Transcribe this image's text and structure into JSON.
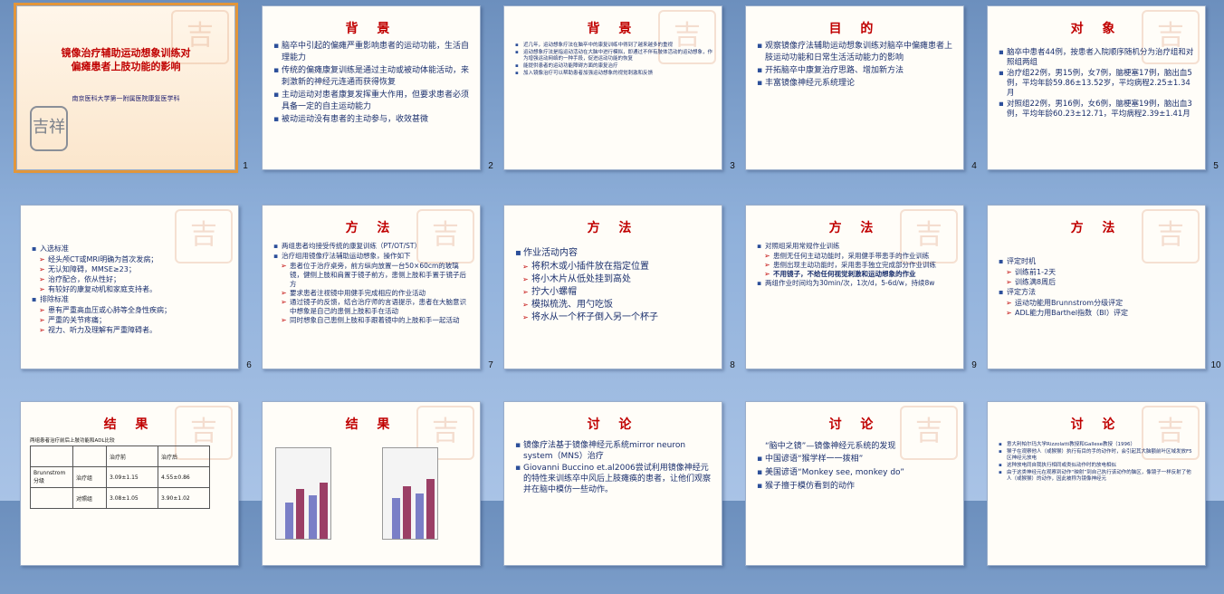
{
  "slides": [
    {
      "num": "1",
      "title_lines": [
        "镜像治疗辅助运动想象训练对",
        "偏瘫患者上肢功能的影响"
      ],
      "affiliation": "南京医科大学第一附属医院康复医学科",
      "seal": "吉祥"
    },
    {
      "num": "2",
      "title": "背 景",
      "bullets": [
        "脑卒中引起的偏瘫严重影响患者的运动功能，生活自理能力",
        "传统的偏瘫康复训练是通过主动或被动体能活动，来刺激新的神经元连通而获得恢复",
        "主动运动对患者康复发挥重大作用，但要求患者必须具备一定的自主运动能力",
        "被动运动没有患者的主动参与，收效甚微"
      ]
    },
    {
      "num": "3",
      "title": "背 景",
      "bullets": [
        "近几年，运动想象疗法在脑卒中的康复训练中得到了越来越多的重视",
        "运动想象疗法是指运动活动在大脑中进行模拟，即通过不伴有肢体活动的运动想象，作为增强运动网络的一种手段，促进运动功能的恢复",
        "能提供患者的运动功能障碍方面的康复治疗",
        "加入镜像治疗可以帮助患者加强运动想象的视觉刺激和反馈"
      ]
    },
    {
      "num": "4",
      "title": "目 的",
      "bullets": [
        "观察镜像疗法辅助运动想象训练对脑卒中偏瘫患者上肢运动功能和日常生活活动能力的影响",
        "开拓脑卒中康复治疗思路、增加新方法",
        "丰富镜像神经元系统理论"
      ]
    },
    {
      "num": "5",
      "title": "对 象",
      "bullets": [
        "脑卒中患者44例，按患者入院顺序随机分为治疗组和对照组两组",
        "治疗组22例，男15例，女7例，脑梗塞17例，脑出血5例，平均年龄59.86±13.52岁，平均病程2.25±1.34月",
        "对照组22例，男16例，女6例，脑梗塞19例，脑出血3例，平均年龄60.23±12.71，平均病程2.39±1.41月"
      ]
    },
    {
      "num": "6",
      "title": "",
      "bullets": [
        "入选标准",
        "经头颅CT或MRI明确为首次发病；",
        "无认知障碍，MMSE≥23；",
        "治疗配合，依从性好；",
        "有较好的康复动机和家庭支持者。",
        "排除标准",
        "患有严重高血压或心肺等全身性疾病；",
        "严重的关节疼痛；",
        "视力、听力及理解有严重障碍者。"
      ]
    },
    {
      "num": "7",
      "title": "方 法",
      "bullets": [
        "两组患者均接受传统的康复训练（PT/OT/ST）",
        "治疗组用镜像疗法辅助运动想象，操作如下",
        "患者位于治疗桌旁，前方纵向放置一台50×60cm的玻璃镜，健侧上肢和肩置于镜子前方，患侧上肢和手置于镜子后方",
        "要求患者注视镜中用健手完成相应的作业活动",
        "通过镜子的反馈，结合治疗师的言语提示，患者在大脑意识中想象是自己的患侧上肢和手在活动",
        "同时想象自己患侧上肢和手跟着镜中的上肢和手一起活动"
      ]
    },
    {
      "num": "8",
      "title": "方 法",
      "bullets": [
        "作业活动内容",
        "将积木或小插件放在指定位置",
        "将小木片从低处挂到高处",
        "拧大小螺帽",
        "模拟梳洗、用勺吃饭",
        "将水从一个杯子倒入另一个杯子"
      ]
    },
    {
      "num": "9",
      "title": "方 法",
      "bullets": [
        "对照组采用常规作业训练",
        "患侧无任何主动功能时，采用健手带患手的作业训练",
        "患侧出现主动功能时，采用患手独立完成部分作业训练",
        "不用镜子，不给任何视觉刺激和运动想象的作业",
        "两组作业时间均为30min/次，1次/d，5-6d/w，持续8w"
      ]
    },
    {
      "num": "10",
      "title": "方 法",
      "bullets": [
        "评定时机",
        "训练前1-2天",
        "训练满8周后",
        "评定方法",
        "运动功能用Brunnstrom分级评定",
        "ADL能力用Barthel指数（BI）评定"
      ]
    },
    {
      "num": "11",
      "title": "结 果",
      "caption": "两组患者治疗前后上肢功能和ADL比较",
      "table": [
        [
          "",
          "",
          "治疗前",
          "治疗后"
        ],
        [
          "Brunnstrom分级",
          "治疗组",
          "3.09±1.15",
          "4.55±0.86"
        ],
        [
          "",
          "对照组",
          "3.08±1.05",
          "3.90±1.02"
        ]
      ]
    },
    {
      "num": "12",
      "title": "结 果"
    },
    {
      "num": "13",
      "title": "讨 论",
      "bullets": [
        "镜像疗法基于镜像神经元系统mirror neuron system（MNS）治疗",
        "Giovanni Buccino et.al2006尝试利用镜像神经元的特性来训练卒中风后上肢瘫痪的患者，让他们观察并在脑中模仿一些动作。"
      ]
    },
    {
      "num": "14",
      "title": "讨 论",
      "bullets": [
        "“脑中之镜”—镜像神经元系统的发现",
        "中国谚语“猴学样一一拨相”",
        "美国谚语“Monkey see, monkey do”",
        "猴子擅于模仿看到的动作"
      ]
    },
    {
      "num": "15",
      "title": "讨 论",
      "bullets": [
        "意大利帕尔玛大学Rizzolatti教授和Gallese教授（1996）",
        "猴子在观察他人（或猴猴）执行有目的手的动作时，会引起其大脑额前叶区域发放F5区神经元放电",
        "这种放电同自我执行相同或类似动作时的放电相似",
        "由于这类神经元在观察到动作“映射”到自己执行该动作的脑区，像镜子一样反射了他人（或猴猴）的动作，因此被称为镜像神经元"
      ]
    }
  ]
}
